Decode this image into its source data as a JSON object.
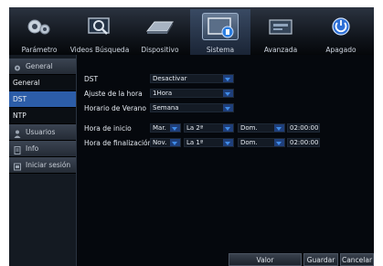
{
  "nav": {
    "tabs": [
      {
        "label": "Parámetro",
        "icon": "gears-icon"
      },
      {
        "label": "Videos Búsqueda",
        "icon": "search-video-icon"
      },
      {
        "label": "Dispositivo",
        "icon": "hard-disk-icon"
      },
      {
        "label": "Sistema",
        "icon": "system-monitor-icon",
        "active": true
      },
      {
        "label": "Avanzada",
        "icon": "advanced-icon"
      },
      {
        "label": "Apagado",
        "icon": "power-icon"
      }
    ]
  },
  "sidebar": {
    "general_group": "General",
    "items": [
      "General",
      "DST",
      "NTP"
    ],
    "selected": "DST",
    "users": "Usuarios",
    "info": "Info",
    "logout": "Iniciar sesión"
  },
  "form": {
    "dst_label": "DST",
    "dst_value": "Desactivar",
    "adjust_label": "Ajuste de la hora",
    "adjust_value": "1Hora",
    "summer_label": "Horario de Verano",
    "summer_value": "Semana",
    "start_label": "Hora de inicio",
    "start_month": "Mar.",
    "start_week": "La 2ª",
    "start_day": "Dom.",
    "start_time": "02:00:00",
    "end_label": "Hora de finalización",
    "end_month": "Nov.",
    "end_week": "La 1ª",
    "end_day": "Dom.",
    "end_time": "02:00:00"
  },
  "buttons": {
    "default": "Valor predeterminado",
    "save": "Guardar",
    "cancel": "Cancelar"
  },
  "colors": {
    "accent": "#2c5da8",
    "dropdown_arrow": "#3f8be8"
  }
}
